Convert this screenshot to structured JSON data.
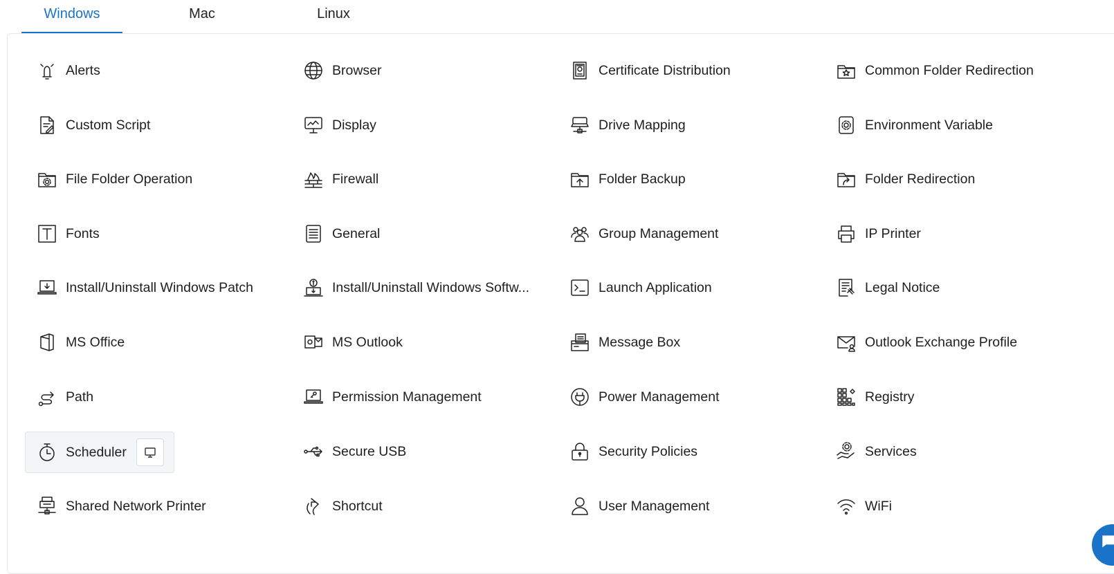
{
  "tabs": [
    {
      "label": "Windows",
      "active": true
    },
    {
      "label": "Mac",
      "active": false
    },
    {
      "label": "Linux",
      "active": false
    }
  ],
  "accent_color": "#1a73c8",
  "policies": [
    [
      {
        "label": "Alerts",
        "icon": "bell-icon"
      },
      {
        "label": "Browser",
        "icon": "globe-icon"
      },
      {
        "label": "Certificate Distribution",
        "icon": "certificate-icon"
      },
      {
        "label": "Common Folder Redirection",
        "icon": "folder-star-icon"
      }
    ],
    [
      {
        "label": "Custom Script",
        "icon": "script-file-icon"
      },
      {
        "label": "Display",
        "icon": "monitor-icon"
      },
      {
        "label": "Drive Mapping",
        "icon": "network-drive-icon"
      },
      {
        "label": "Environment Variable",
        "icon": "gear-square-icon"
      }
    ],
    [
      {
        "label": "File Folder Operation",
        "icon": "folder-gear-icon"
      },
      {
        "label": "Firewall",
        "icon": "firewall-icon"
      },
      {
        "label": "Folder Backup",
        "icon": "folder-upload-icon"
      },
      {
        "label": "Folder Redirection",
        "icon": "folder-arrow-icon"
      }
    ],
    [
      {
        "label": "Fonts",
        "icon": "font-icon"
      },
      {
        "label": "General",
        "icon": "document-lines-icon"
      },
      {
        "label": "Group Management",
        "icon": "group-icon"
      },
      {
        "label": "IP Printer",
        "icon": "printer-icon"
      }
    ],
    [
      {
        "label": "Install/Uninstall Windows Patch",
        "icon": "laptop-download-icon"
      },
      {
        "label": "Install/Uninstall Windows Softw...",
        "icon": "software-install-icon"
      },
      {
        "label": "Launch Application",
        "icon": "terminal-icon"
      },
      {
        "label": "Legal Notice",
        "icon": "legal-document-icon"
      }
    ],
    [
      {
        "label": "MS Office",
        "icon": "office-icon"
      },
      {
        "label": "MS Outlook",
        "icon": "outlook-icon"
      },
      {
        "label": "Message Box",
        "icon": "message-box-icon"
      },
      {
        "label": "Outlook Exchange Profile",
        "icon": "mail-user-icon"
      }
    ],
    [
      {
        "label": "Path",
        "icon": "path-icon"
      },
      {
        "label": "Permission Management",
        "icon": "laptop-key-icon"
      },
      {
        "label": "Power Management",
        "icon": "power-plug-icon"
      },
      {
        "label": "Registry",
        "icon": "registry-icon"
      }
    ],
    [
      {
        "label": "Scheduler",
        "icon": "stopwatch-icon"
      },
      {
        "label": "Secure USB",
        "icon": "usb-icon"
      },
      {
        "label": "Security Policies",
        "icon": "lock-icon"
      },
      {
        "label": "Services",
        "icon": "hand-gear-icon"
      }
    ],
    [
      {
        "label": "Shared Network Printer",
        "icon": "network-printer-icon"
      },
      {
        "label": "Shortcut",
        "icon": "shortcut-icon"
      },
      {
        "label": "User Management",
        "icon": "user-icon"
      },
      {
        "label": "WiFi",
        "icon": "wifi-icon"
      }
    ]
  ],
  "hovered_item": "Scheduler",
  "hover_action_icon": "monitor-icon",
  "chat_button_icon": "chat-icon"
}
